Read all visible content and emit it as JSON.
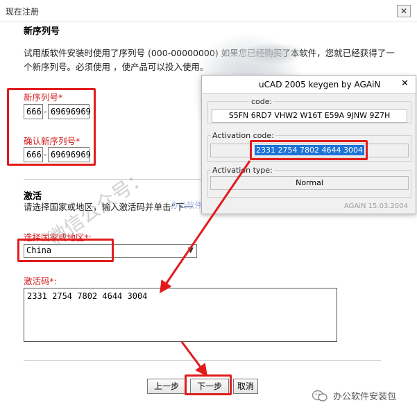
{
  "window": {
    "title": "现在注册",
    "close_symbol": "✕"
  },
  "serial_section": {
    "heading": "新序列号",
    "paragraph": "试用版软件安装时使用了序列号 (000-00000000)                    如果您已经购买了本软件，您就已经获得了一个新序列号。必须使用                    ，使产品可以投入使用。",
    "new_serial_label": "新序列号*",
    "new_serial_prefix": "666",
    "new_serial_number": "69696969",
    "confirm_serial_label": "确认新序列号*",
    "confirm_serial_prefix": "666",
    "confirm_serial_number": "69696969",
    "dash": "-"
  },
  "activation_section": {
    "heading": "激活",
    "instruction": "请选择国家或地区，输入激活码并单击“下一",
    "country_label": "选择国家或地区*:",
    "country_value": "China",
    "country_arrow": "▼",
    "code_label": "激活码*:",
    "code_value": "2331 2754 7802 4644 3004"
  },
  "buttons": {
    "back": "上一步",
    "next": "下一步",
    "cancel": "取消"
  },
  "keygen": {
    "title": "uCAD 2005 keygen by AGAiN",
    "close_symbol": "✕",
    "request_label": "code:",
    "request_value": "S5FN 6RD7 VHW2 W16T E59A 9JNW 9Z7H",
    "activation_label": "Activation code:",
    "activation_value": "2331 2754 7802 4644 3004",
    "type_label": "Activation type:",
    "type_value": "Normal",
    "footer": "AGAiN 15.03.2004"
  },
  "watermarks": {
    "diagonal": "微信公众号：",
    "center": "办公软件安装包",
    "brand": "办公软件安装包"
  },
  "colors": {
    "annotation_red": "#e11b1b",
    "highlight_blue": "#1e73d8"
  }
}
